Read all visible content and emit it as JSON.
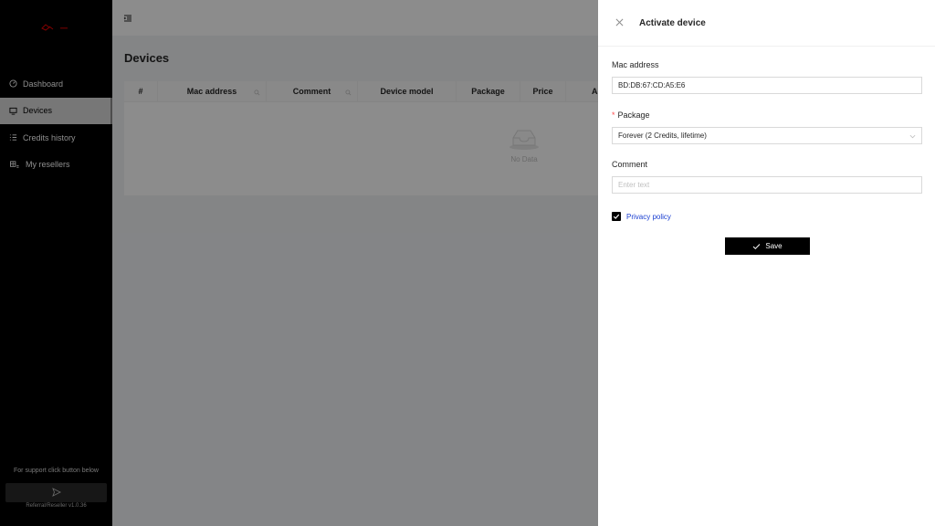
{
  "sidebar": {
    "items": [
      {
        "label": "Dashboard",
        "icon": "dashboard-icon",
        "active": false
      },
      {
        "label": "Devices",
        "icon": "devices-icon",
        "active": true
      },
      {
        "label": "Credits history",
        "icon": "list-icon",
        "active": false
      },
      {
        "label": "My resellers",
        "icon": "resellers-icon",
        "active": false
      }
    ],
    "support_text": "For support click button below",
    "version": "Referral/Reseller v1.0.36"
  },
  "main": {
    "page_title": "Devices",
    "columns": [
      "#",
      "Mac address",
      "Comment",
      "Device model",
      "Package",
      "Price",
      "A"
    ],
    "empty_text": "No Data"
  },
  "drawer": {
    "title": "Activate device",
    "mac_label": "Mac address",
    "mac_value": "BD:DB:67:CD:A5:E6",
    "package_label": "Package",
    "package_value": "Forever (2 Credits, lifetime)",
    "comment_label": "Comment",
    "comment_placeholder": "Enter text",
    "privacy_label": "Privacy policy",
    "save_label": "Save"
  },
  "colors": {
    "sidebar_bg": "#000000",
    "link": "#1a3fd1",
    "required": "#ff4d4f",
    "button_bg": "#000000"
  }
}
